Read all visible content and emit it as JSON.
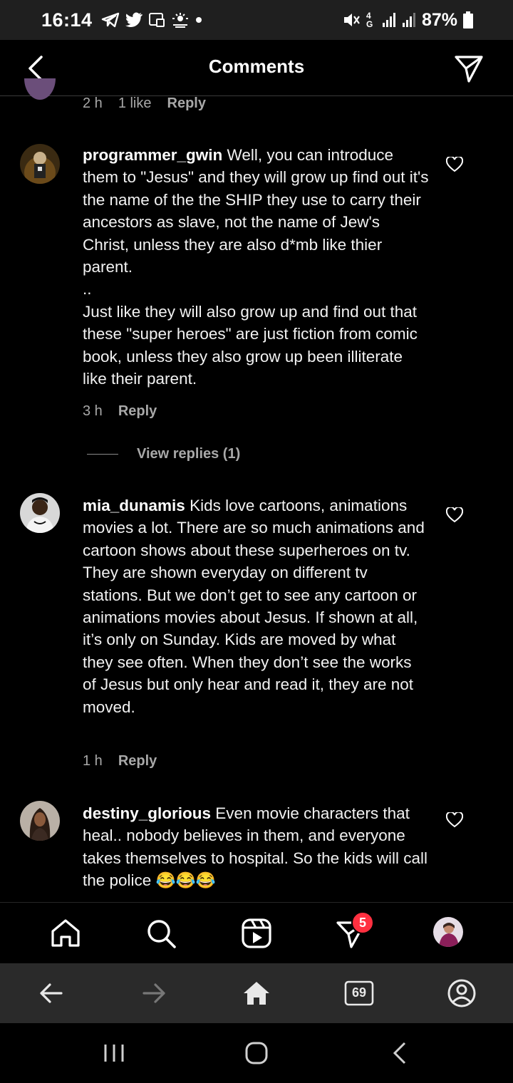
{
  "status_bar": {
    "time": "16:14",
    "network": "4G",
    "battery": "87%",
    "icons_left": [
      "telegram-icon",
      "twitter-icon",
      "cast-icon",
      "weather-icon",
      "dot-icon"
    ],
    "icons_right": [
      "mute-icon",
      "signal-icon",
      "signal-icon",
      "battery-icon"
    ]
  },
  "header": {
    "title": "Comments"
  },
  "previous_comment_meta": {
    "time": "2 h",
    "likes": "1 like",
    "reply": "Reply"
  },
  "comments": [
    {
      "username": "programmer_gwin",
      "text": " Well, you can introduce them to \"Jesus\" and they will grow up find out it's the name of the the SHIP they use to carry their ancestors as slave, not the name of Jew's Christ, unless they are also d*mb like thier parent.\n..\nJust like they will also grow up and find out that these \"super heroes\" are just fiction from comic book, unless they also grow up been illiterate like their parent.",
      "time": "3 h",
      "reply": "Reply",
      "view_replies": "View replies (1)"
    },
    {
      "username": "mia_dunamis",
      "text": " Kids love cartoons, animations movies a lot. There are so much animations and cartoon shows about these superheroes on tv. They are shown everyday on different tv stations. But we don’t get to see any cartoon or animations movies about Jesus. If shown at all, it’s only on Sunday. Kids are moved by what they see often. When they don’t see the works of Jesus but only hear and read it, they are not moved.",
      "time": "1 h",
      "reply": "Reply"
    },
    {
      "username": "destiny_glorious",
      "text": " Even movie characters that heal.. nobody believes in them, and everyone takes themselves to hospital. So the kids will call the police 😂😂😂"
    }
  ],
  "bottom_nav": {
    "items": [
      "home-icon",
      "search-icon",
      "reels-icon",
      "direct-messages-icon",
      "profile-avatar"
    ],
    "badge": "5"
  },
  "browser_bar": {
    "items": [
      "back-arrow-icon",
      "forward-arrow-icon",
      "home-icon",
      "tabs-icon",
      "account-icon"
    ],
    "tabs_count": "69"
  },
  "colors": {
    "background": "#000000",
    "secondary_text": "#a8a8a8",
    "badge": "#ff3040",
    "browser_bar": "#2a2a2a"
  }
}
